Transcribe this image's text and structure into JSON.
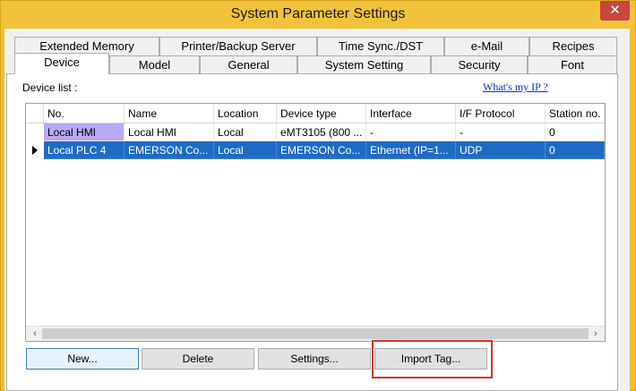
{
  "window": {
    "title": "System Parameter Settings",
    "close_symbol": "✕"
  },
  "tabs_row1": [
    "Extended Memory",
    "Printer/Backup Server",
    "Time Sync./DST",
    "e-Mail",
    "Recipes"
  ],
  "tabs_row2": [
    "Device",
    "Model",
    "General",
    "System Setting",
    "Security",
    "Font"
  ],
  "active_tab": "Device",
  "device_list_label": "Device list :",
  "whats_my_ip": "What's my IP ?",
  "table": {
    "columns": [
      "No.",
      "Name",
      "Location",
      "Device type",
      "Interface",
      "I/F Protocol",
      "Station no."
    ],
    "rows": [
      [
        "Local HMI",
        "Local HMI",
        "Local",
        "eMT3105 (800 ...",
        "-",
        "-",
        "0"
      ],
      [
        "Local PLC 4",
        "EMERSON Co...",
        "Local",
        "EMERSON Co...",
        "Ethernet (IP=1...",
        "UDP",
        "0"
      ]
    ],
    "selected_row": 1
  },
  "scrollbar": {
    "left_arrow": "‹",
    "right_arrow": "›"
  },
  "buttons": {
    "new": "New...",
    "delete": "Delete",
    "settings": "Settings...",
    "import_tag": "Import Tag..."
  },
  "colors": {
    "selection": "#1e6bc5",
    "hmi_highlight": "#b9a8f5",
    "annotation_box": "#d9302c",
    "link": "#0033cc"
  }
}
